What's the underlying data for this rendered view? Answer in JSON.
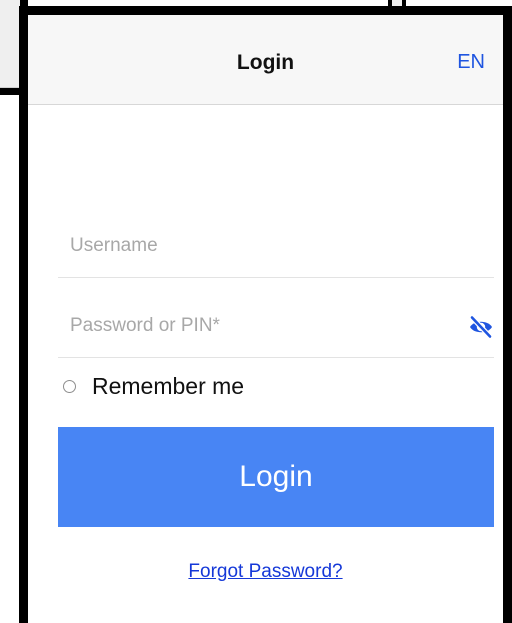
{
  "nav": {
    "title": "Login",
    "language": "EN"
  },
  "form": {
    "username_placeholder": "Username",
    "username_value": "",
    "password_placeholder": "Password or PIN*",
    "password_value": "",
    "password_toggle_icon": "eye-slash-icon",
    "remember_label": "Remember me",
    "remember_checked": false,
    "login_label": "Login",
    "forgot_label": "Forgot Password?"
  },
  "colors": {
    "accent": "#4885f4",
    "link": "#1538d8",
    "nav_link": "#1f55e0"
  }
}
